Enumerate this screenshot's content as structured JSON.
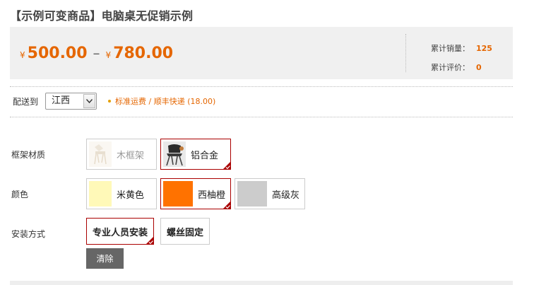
{
  "product": {
    "title": "【示例可变商品】电脑桌无促销示例"
  },
  "price": {
    "currency": "¥",
    "min": "500.00",
    "separator": "–",
    "max": "780.00"
  },
  "stats": {
    "sales_label": "累计销量：",
    "sales_value": "125",
    "reviews_label": "累计评价：",
    "reviews_value": "0"
  },
  "shipping": {
    "label": "配送到",
    "region": "江西",
    "info": "标准运费 / 顺丰快递 (18.00)"
  },
  "options": [
    {
      "label": "框架材质",
      "values": [
        {
          "text": "木框架",
          "selected": false,
          "disabled": true,
          "thumb": "wood-frame-chair-thumb"
        },
        {
          "text": "铝合金",
          "selected": true,
          "disabled": false,
          "thumb": "aluminum-chair-thumb"
        }
      ]
    },
    {
      "label": "颜色",
      "values": [
        {
          "text": "米黄色",
          "selected": false,
          "swatch": "#fff9b8"
        },
        {
          "text": "西柚橙",
          "selected": true,
          "swatch": "#ff7200"
        },
        {
          "text": "高级灰",
          "selected": false,
          "swatch": "#cccccc"
        }
      ]
    },
    {
      "label": "安装方式",
      "values": [
        {
          "text": "专业人员安装",
          "selected": true
        },
        {
          "text": "螺丝固定",
          "selected": false
        }
      ]
    }
  ],
  "clear_label": "清除",
  "colors": {
    "accent": "#e56600",
    "selected_border": "#aa0000"
  }
}
